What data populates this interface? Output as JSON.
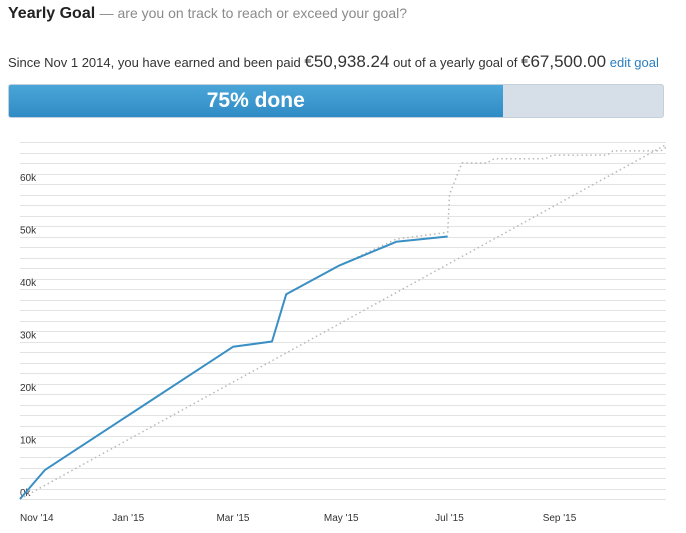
{
  "header": {
    "title": "Yearly Goal",
    "subtitle": "— are you on track to reach or exceed your goal?"
  },
  "summary": {
    "prefix": "Since Nov 1 2014, you have earned and been paid",
    "earned": "€50,938.24",
    "middle": "out of a yearly goal of",
    "goal": "€67,500.00",
    "edit_label": "edit goal"
  },
  "progress": {
    "label": "75% done",
    "fraction": 0.7546,
    "fill_color": "#3a96cf",
    "track_color": "#d6dfe7"
  },
  "chart_data": {
    "type": "line",
    "x_tick_labels": [
      "Nov '14",
      "Jan '15",
      "Mar '15",
      "May '15",
      "Jul '15",
      "Sep '15"
    ],
    "y_tick_labels": [
      "0k",
      "10k",
      "20k",
      "30k",
      "40k",
      "50k",
      "60k"
    ],
    "ylim": [
      0,
      68000
    ],
    "xlim": [
      "2014-11-01",
      "2015-10-31"
    ],
    "grid": true,
    "series": [
      {
        "style": "solid",
        "color": "#3a8fc4",
        "points": [
          {
            "x": "2014-11-01",
            "y": 0
          },
          {
            "x": "2014-11-15",
            "y": 5500
          },
          {
            "x": "2015-03-01",
            "y": 29000
          },
          {
            "x": "2015-03-23",
            "y": 30000
          },
          {
            "x": "2015-03-31",
            "y": 39000
          },
          {
            "x": "2015-04-30",
            "y": 44500
          },
          {
            "x": "2015-06-01",
            "y": 49000
          },
          {
            "x": "2015-06-30",
            "y": 50000
          }
        ]
      },
      {
        "style": "dotted",
        "color": "#b8b8b8",
        "points": [
          {
            "x": "2014-11-01",
            "y": 0
          },
          {
            "x": "2014-11-15",
            "y": 5500
          },
          {
            "x": "2015-03-01",
            "y": 29000
          },
          {
            "x": "2015-03-23",
            "y": 30000
          },
          {
            "x": "2015-03-31",
            "y": 39000
          },
          {
            "x": "2015-04-30",
            "y": 44500
          },
          {
            "x": "2015-06-01",
            "y": 49500
          },
          {
            "x": "2015-06-30",
            "y": 50800
          },
          {
            "x": "2015-07-01",
            "y": 58000
          },
          {
            "x": "2015-07-08",
            "y": 64000
          },
          {
            "x": "2015-07-22",
            "y": 64000
          },
          {
            "x": "2015-07-26",
            "y": 64800
          },
          {
            "x": "2015-08-24",
            "y": 64800
          },
          {
            "x": "2015-08-28",
            "y": 65500
          },
          {
            "x": "2015-09-28",
            "y": 65500
          },
          {
            "x": "2015-10-01",
            "y": 66300
          },
          {
            "x": "2015-10-28",
            "y": 66300
          },
          {
            "x": "2015-10-31",
            "y": 67000
          }
        ]
      },
      {
        "style": "dotted",
        "color": "#b8b8b8",
        "points": [
          {
            "x": "2014-11-01",
            "y": 0
          },
          {
            "x": "2015-10-31",
            "y": 67500
          }
        ]
      }
    ]
  }
}
